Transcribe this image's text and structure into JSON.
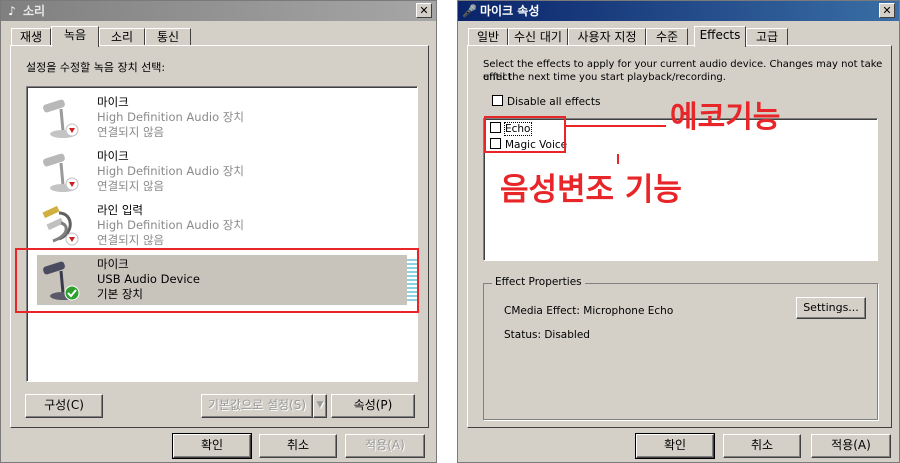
{
  "left_dialog": {
    "title": "소리",
    "tabs": [
      {
        "label": "재생"
      },
      {
        "label": "녹음"
      },
      {
        "label": "소리"
      },
      {
        "label": "통신"
      }
    ],
    "instruction": "설정을 수정할 녹음 장치 선택:",
    "devices": [
      {
        "name": "마이크",
        "desc1": "High Definition Audio 장치",
        "desc2": "연결되지 않음",
        "icon": "microphone-disconnected-icon"
      },
      {
        "name": "마이크",
        "desc1": "High Definition Audio 장치",
        "desc2": "연결되지 않음",
        "icon": "microphone-disconnected-icon"
      },
      {
        "name": "라인 입력",
        "desc1": "High Definition Audio 장치",
        "desc2": "연결되지 않음",
        "icon": "line-in-disconnected-icon"
      },
      {
        "name": "마이크",
        "desc1": "USB Audio Device",
        "desc2": "기본 장치",
        "icon": "microphone-default-icon"
      }
    ],
    "buttons": {
      "configure": "구성(C)",
      "set_default": "기본값으로 설정(S)",
      "properties": "속성(P)",
      "ok": "확인",
      "cancel": "취소",
      "apply": "적용(A)"
    }
  },
  "right_dialog": {
    "title": "마이크 속성",
    "tabs": [
      {
        "label": "일반"
      },
      {
        "label": "수신 대기"
      },
      {
        "label": "사용자 지정"
      },
      {
        "label": "수준"
      },
      {
        "label": "Effects"
      },
      {
        "label": "고급"
      }
    ],
    "description_line1": "Select the effects to apply for your current audio device. Changes may not take effect",
    "description_line2": "until the next time you start playback/recording.",
    "disable_all": "Disable all effects",
    "effects": [
      {
        "label": "Echo",
        "checked": false
      },
      {
        "label": "Magic Voice",
        "checked": false
      }
    ],
    "properties": {
      "group_title": "Effect Properties",
      "effect_name": "CMedia Effect: Microphone Echo",
      "status": "Status: Disabled",
      "settings_button": "Settings..."
    },
    "buttons": {
      "ok": "확인",
      "cancel": "취소",
      "apply": "적용(A)"
    }
  },
  "annotations": {
    "echo": "에코기능",
    "voice_change": "음성변조 기능",
    "color": "#e8262a"
  }
}
